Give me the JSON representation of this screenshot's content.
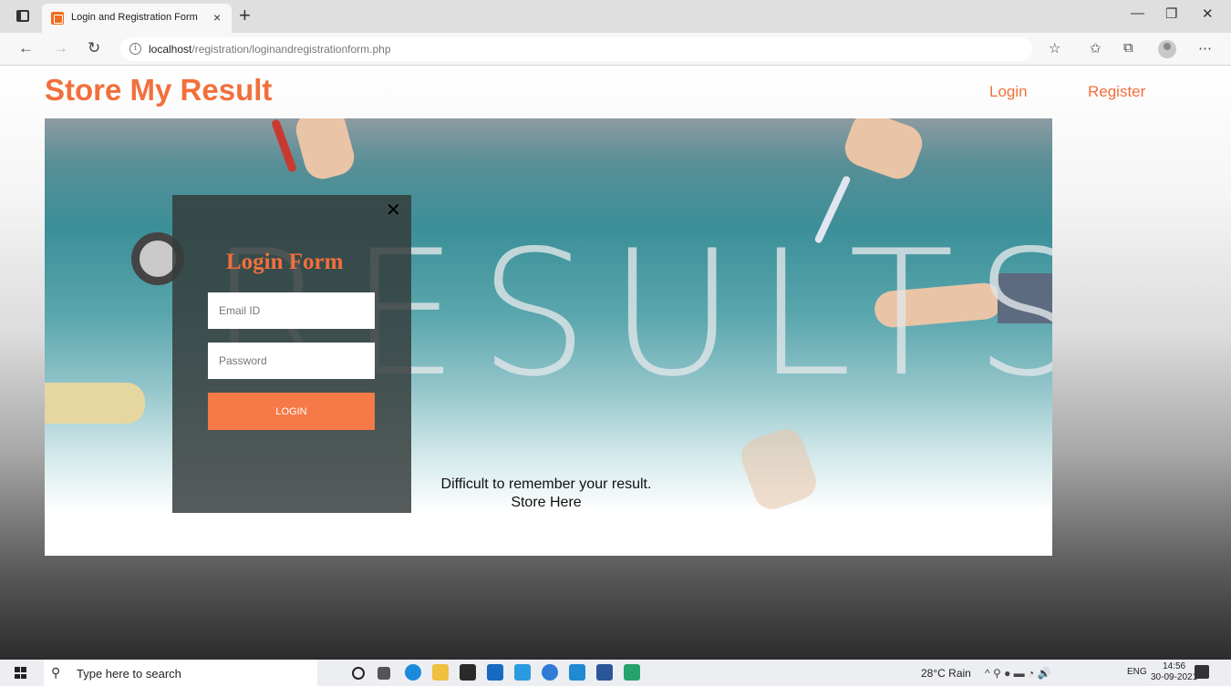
{
  "browser": {
    "tab_title": "Login and Registration Form",
    "tab_close": "×",
    "new_tab": "+",
    "url_host": "localhost",
    "url_path": "/registration/loginandregistrationform.php",
    "back": "←",
    "forward": "→",
    "refresh": "↻",
    "minimize": "—",
    "maximize": "❐",
    "close": "✕",
    "toolbar_icons": [
      "☆",
      "✩",
      "⧉",
      "⋯"
    ]
  },
  "header": {
    "brand": "Store My Result",
    "nav": {
      "login": "Login",
      "register": "Register"
    }
  },
  "hero": {
    "word": "RESULTS",
    "caption_line1": "Difficult to remember your result.",
    "caption_line2": "Store Here"
  },
  "login_form": {
    "close": "✕",
    "title": "Login Form",
    "email_placeholder": "Email ID",
    "password_placeholder": "Password",
    "button": "LOGIN"
  },
  "taskbar": {
    "search_placeholder": "Type here to search",
    "weather": "28°C  Rain",
    "tray_symbols": "^  ⚲  ●  ▬  ◔  🔊",
    "language": "ENG",
    "time": "14:56",
    "date": "30-09-2021"
  },
  "colors": {
    "accent": "#f26f3c",
    "button": "#f57a47",
    "modal_bg": "#343c3a"
  }
}
